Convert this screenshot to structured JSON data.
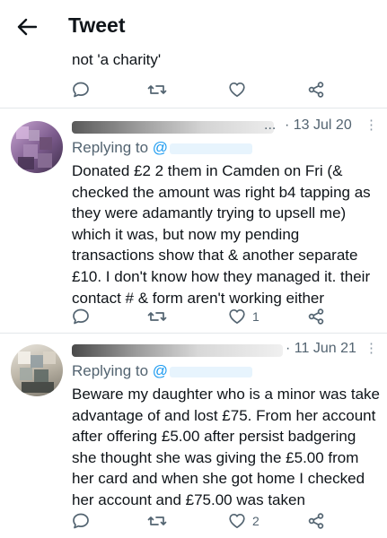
{
  "header": {
    "title": "Tweet",
    "back_icon": "arrow-left-icon"
  },
  "previous_tweet": {
    "text_tail": "not 'a charity'"
  },
  "replies": [
    {
      "name_suffix": "...",
      "date": "· 13 Jul 20",
      "more": "⋮",
      "replying_label": "Replying to ",
      "replying_handle": "@",
      "text": "Donated £2 2 them in Camden on Fri (& checked the amount was right b4 tapping as they were adamantly trying to upsell me) which it was, but now my pending transactions show that & another separate £10. I don't know how they managed it. their contact # & form aren't working either",
      "likes": "1"
    },
    {
      "name_suffix": "",
      "date": "· 11 Jun 21",
      "more": "⋮",
      "replying_label": "Replying to ",
      "replying_handle": "@",
      "text": "Beware my daughter who is a minor was take advantage of and lost £75. From her account after offering £5.00 after persist badgering she thought she was giving the £5.00 from her card and when she got home I checked her account and £75.00 was taken",
      "likes": "2"
    }
  ],
  "colors": {
    "text": "#0f1419",
    "secondary": "#536471",
    "accent": "#1d9bf0",
    "icon": "#536471",
    "divider": "#e3e7ea"
  }
}
